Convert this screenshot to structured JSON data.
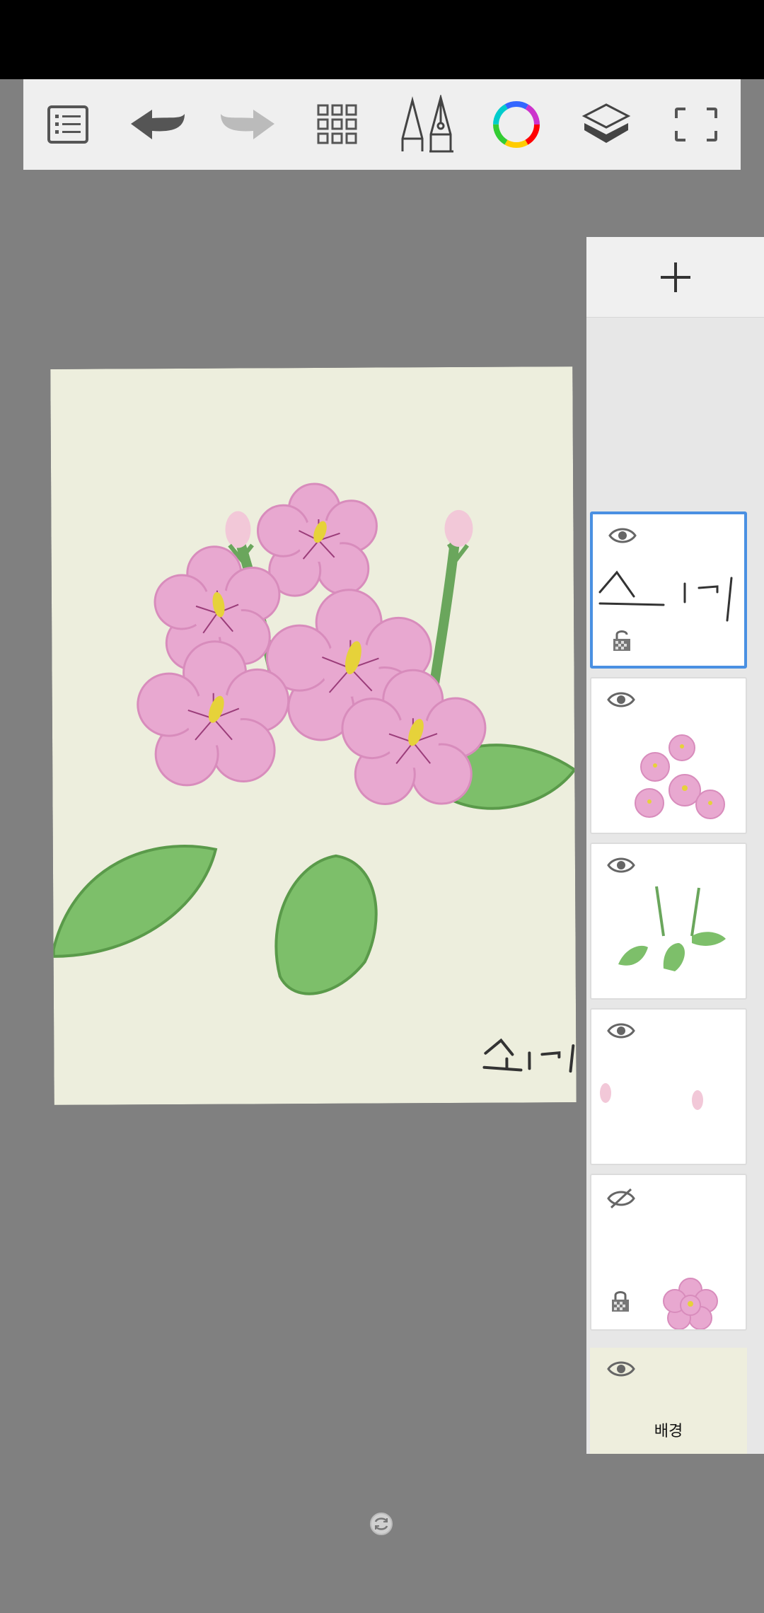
{
  "toolbar": {
    "items": [
      {
        "icon": "menu-list-icon"
      },
      {
        "icon": "undo-icon"
      },
      {
        "icon": "redo-icon"
      },
      {
        "icon": "brush-grid-icon"
      },
      {
        "icon": "brush-pens-icon"
      },
      {
        "icon": "color-wheel-icon"
      },
      {
        "icon": "layers-icon"
      },
      {
        "icon": "fullscreen-icon"
      }
    ]
  },
  "canvas": {
    "background_color": "#edeedd",
    "signature": "소니"
  },
  "layers": {
    "add_icon": "plus-icon",
    "items": [
      {
        "name": "signature-layer",
        "visible": true,
        "locked": true,
        "selected": true
      },
      {
        "name": "flowers-layer",
        "visible": true,
        "locked": false,
        "selected": false
      },
      {
        "name": "stems-leaves-layer",
        "visible": true,
        "locked": false,
        "selected": false
      },
      {
        "name": "buds-layer",
        "visible": true,
        "locked": false,
        "selected": false
      },
      {
        "name": "single-flower-layer",
        "visible": false,
        "locked": true,
        "selected": false
      }
    ],
    "background": {
      "label": "배경",
      "visible": true
    }
  },
  "colors": {
    "accent": "#4a90e2",
    "petal": "#e8a8d0",
    "leaf": "#7dbf6a",
    "stamen": "#e6d23a"
  }
}
